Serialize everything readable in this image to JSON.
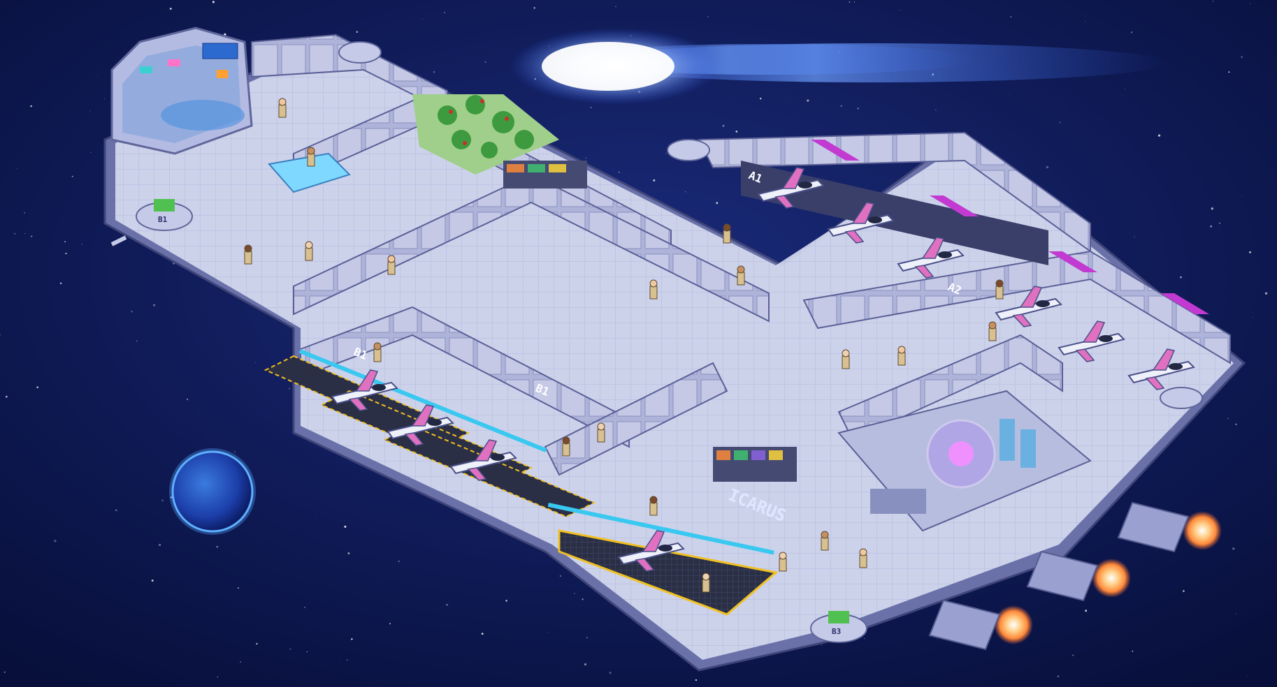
{
  "scene": {
    "ship_name": "ICARUS",
    "deck_labels": {
      "a1": "A1",
      "a2": "A2",
      "b1_left": "B1",
      "b1_center": "B1",
      "pod_b1": "B1",
      "pod_b3": "B3"
    }
  },
  "colors": {
    "space": "#0b1650",
    "hull_light": "#c9cde8",
    "hull_mid": "#8f95c4",
    "hull_dark": "#5d6399",
    "floor": "#d6dbf0",
    "accent_cyan": "#39c8f0",
    "accent_magenta": "#c23ad1",
    "engine_glow": "#ffb060",
    "comet": "#e8f2ff",
    "planet": "#2b5fd0"
  }
}
